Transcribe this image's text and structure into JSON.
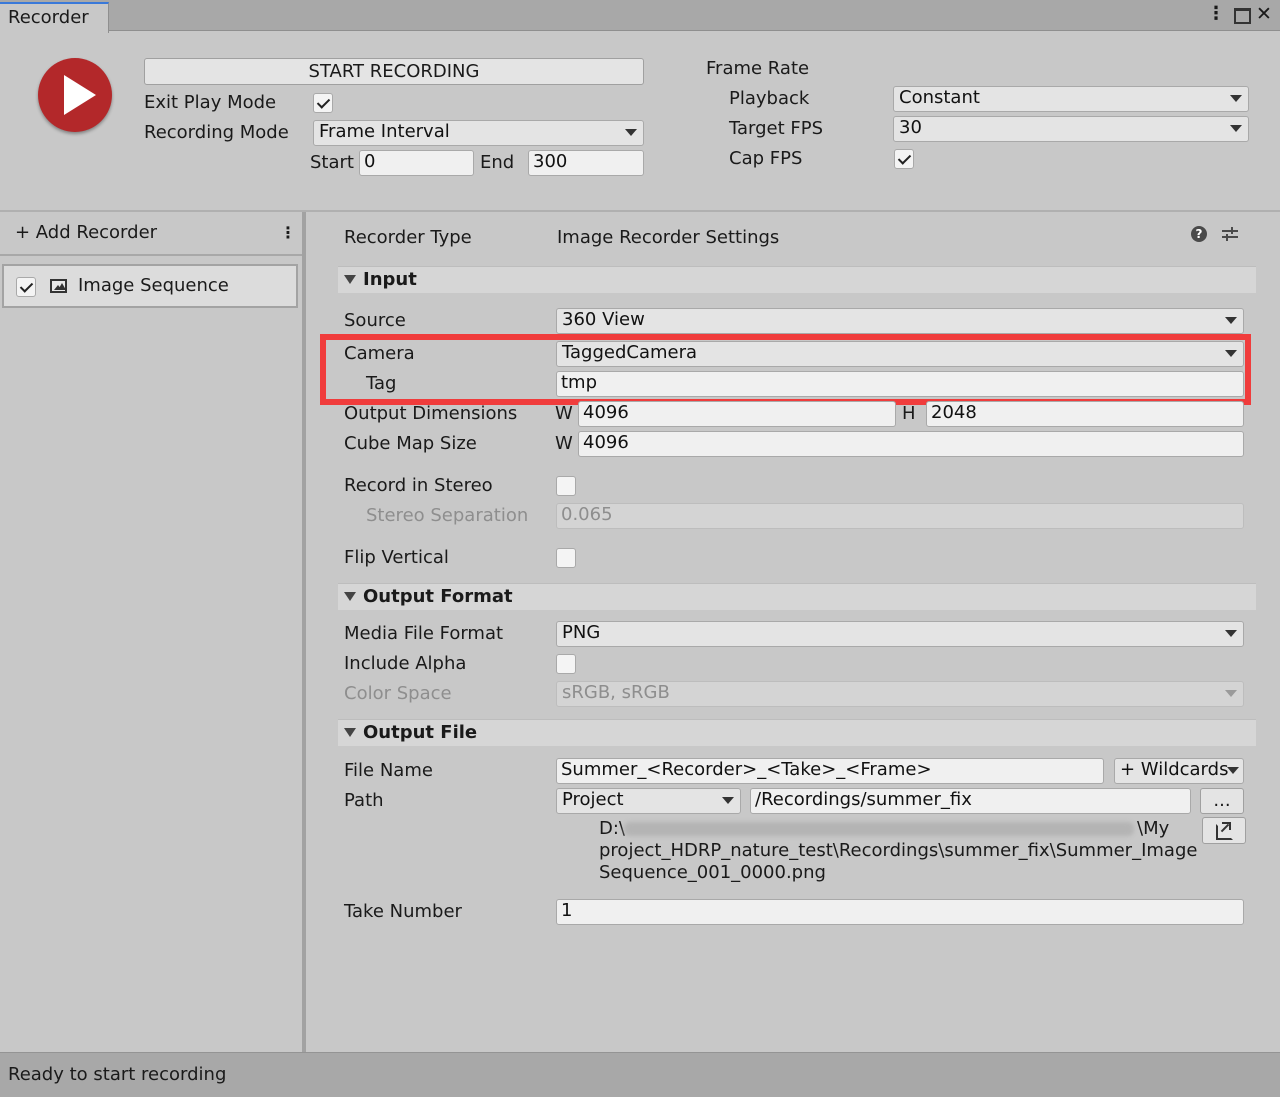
{
  "window": {
    "tab_title": "Recorder"
  },
  "top": {
    "start_button": "START RECORDING",
    "exit_play_mode_label": "Exit Play Mode",
    "exit_play_mode_checked": true,
    "recording_mode_label": "Recording Mode",
    "recording_mode_value": "Frame Interval",
    "start_label": "Start",
    "start_value": "0",
    "end_label": "End",
    "end_value": "300",
    "frame_rate_label": "Frame Rate",
    "playback_label": "Playback",
    "playback_value": "Constant",
    "target_fps_label": "Target FPS",
    "target_fps_value": "30",
    "cap_fps_label": "Cap FPS",
    "cap_fps_checked": true
  },
  "sidebar": {
    "add_recorder": "+ Add Recorder",
    "recorders": [
      {
        "label": "Image Sequence",
        "enabled": true
      }
    ]
  },
  "settings": {
    "recorder_type_label": "Recorder Type",
    "recorder_type_value": "Image Recorder Settings",
    "input": {
      "header": "Input",
      "source_label": "Source",
      "source_value": "360 View",
      "camera_label": "Camera",
      "camera_value": "TaggedCamera",
      "tag_label": "Tag",
      "tag_value": "tmp",
      "output_dimensions_label": "Output Dimensions",
      "w_label": "W",
      "width_value": "4096",
      "h_label": "H",
      "height_value": "2048",
      "cube_map_label": "Cube Map Size",
      "cube_w_label": "W",
      "cube_map_value": "4096",
      "record_stereo_label": "Record in Stereo",
      "record_stereo_checked": false,
      "stereo_separation_label": "Stereo Separation",
      "stereo_separation_value": "0.065",
      "flip_vertical_label": "Flip Vertical",
      "flip_vertical_checked": false
    },
    "output_format": {
      "header": "Output Format",
      "media_format_label": "Media File Format",
      "media_format_value": "PNG",
      "include_alpha_label": "Include Alpha",
      "include_alpha_checked": false,
      "color_space_label": "Color Space",
      "color_space_value": "sRGB, sRGB"
    },
    "output_file": {
      "header": "Output File",
      "file_name_label": "File Name",
      "file_name_value": "Summer_<Recorder>_<Take>_<Frame>",
      "wildcards_label": "+ Wildcards",
      "path_label": "Path",
      "path_root_value": "Project",
      "path_value": "/Recordings/summer_fix",
      "browse_label": "...",
      "resolved_path_line1_start": "D:\\",
      "resolved_path_line1_end": "\\My",
      "resolved_path_line2": "project_HDRP_nature_test\\Recordings\\summer_fix\\Summer_Image",
      "resolved_path_line3": "Sequence_001_0000.png",
      "take_number_label": "Take Number",
      "take_number_value": "1"
    }
  },
  "status_bar": {
    "message": "Ready to start recording"
  },
  "colors": {
    "record_button": "#b3282a",
    "highlight_box": "#f03c3c",
    "tab_accent": "#3a79d9"
  }
}
